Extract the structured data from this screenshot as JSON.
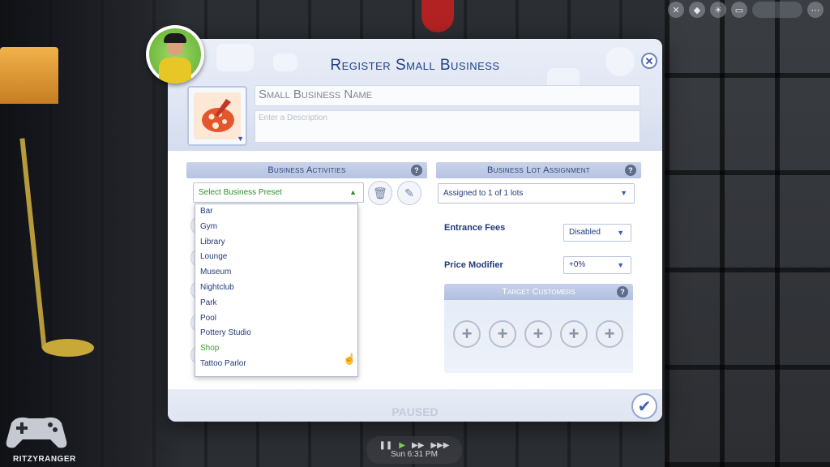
{
  "dialog": {
    "title": "Register Small Business",
    "close_icon": "close-icon",
    "name_placeholder": "Small Business Name",
    "description_placeholder": "Enter a Description"
  },
  "business_activities": {
    "header": "Business Activities",
    "preset_label": "Select Business Preset",
    "options": [
      "Bar",
      "Gym",
      "Library",
      "Lounge",
      "Museum",
      "Nightclub",
      "Park",
      "Pool",
      "Pottery Studio",
      "Shop",
      "Tattoo Parlor"
    ],
    "hovered_option": "Shop"
  },
  "lot_assignment": {
    "header": "Business Lot Assignment",
    "lot_value": "Assigned to 1 of 1 lots",
    "entrance_fees_label": "Entrance Fees",
    "entrance_fees_value": "Disabled",
    "price_modifier_label": "Price Modifier",
    "price_modifier_value": "+0%"
  },
  "target_customers": {
    "header": "Target Customers",
    "slots": [
      "add-customer-1",
      "add-customer-2",
      "add-customer-3",
      "add-customer-4",
      "add-customer-5"
    ]
  },
  "footer": {
    "paused_text": "PAUSED"
  },
  "hud": {
    "money": ""
  },
  "watermark": {
    "name": "RITZYRANGER"
  },
  "speed": {
    "time": "Sun 6:31 PM"
  },
  "colors": {
    "title_blue": "#1e3f8a",
    "selected_green": "#3f9c2f",
    "section_bar": "#b6c3e1"
  }
}
